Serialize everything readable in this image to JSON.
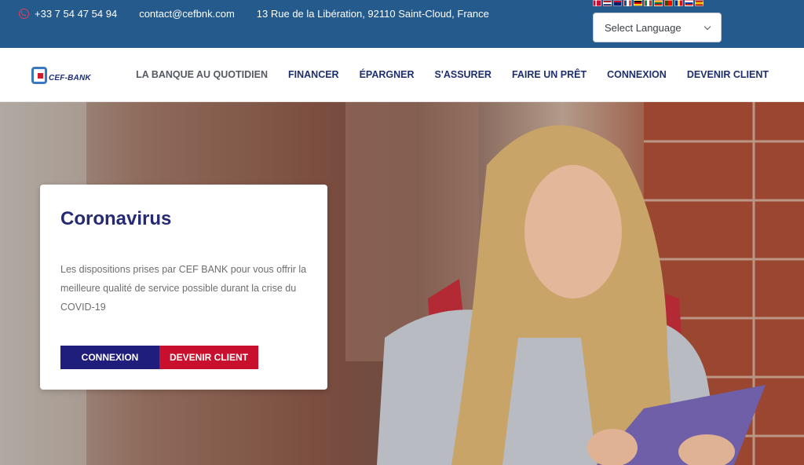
{
  "topbar": {
    "phone": "+33 7 54 47 54 94",
    "email": "contact@cefbnk.com",
    "address": "13 Rue de la Libération, 92110 Saint-Cloud, France",
    "language_select": {
      "value": "Select Language"
    },
    "flags": [
      {
        "icon": "flag-denmark-icon",
        "colors": [
          "#c60c30",
          "#ffffff"
        ]
      },
      {
        "icon": "flag-netherlands-icon",
        "colors": [
          "#ae1c28",
          "#ffffff",
          "#21468b"
        ]
      },
      {
        "icon": "flag-uk-icon",
        "colors": [
          "#012169",
          "#ffffff",
          "#c8102e"
        ]
      },
      {
        "icon": "flag-france-icon",
        "colors": [
          "#0055a4",
          "#ffffff",
          "#ef4135"
        ]
      },
      {
        "icon": "flag-germany-icon",
        "colors": [
          "#000000",
          "#dd0000",
          "#ffce00"
        ]
      },
      {
        "icon": "flag-italy-icon",
        "colors": [
          "#009246",
          "#ffffff",
          "#ce2b37"
        ]
      },
      {
        "icon": "flag-lithuania-icon",
        "colors": [
          "#fdb913",
          "#006a44",
          "#c1272d"
        ]
      },
      {
        "icon": "flag-portugal-icon",
        "colors": [
          "#006600",
          "#ff0000"
        ]
      },
      {
        "icon": "flag-romania-icon",
        "colors": [
          "#002b7f",
          "#fcd116",
          "#ce1126"
        ]
      },
      {
        "icon": "flag-russia-icon",
        "colors": [
          "#ffffff",
          "#0039a6",
          "#d52b1e"
        ]
      },
      {
        "icon": "flag-spain-icon",
        "colors": [
          "#aa151b",
          "#f1bf00",
          "#aa151b"
        ]
      }
    ]
  },
  "logo": {
    "text": "CEF-BANK"
  },
  "nav": {
    "items": [
      "LA BANQUE AU QUOTIDIEN",
      "FINANCER",
      "ÉPARGNER",
      "S'ASSURER",
      "FAIRE UN PRÊT",
      "CONNEXION",
      "DEVENIR CLIENT"
    ]
  },
  "hero": {
    "card": {
      "title": "Coronavirus",
      "body": "Les dispositions prises par CEF BANK pour vous offrir la meilleure qualité de service possible durant la crise du COVID-19",
      "primary_button": "CONNEXION",
      "secondary_button": "DEVENIR CLIENT"
    }
  },
  "colors": {
    "topbar": "#245a8c",
    "nav_text": "#1f2f6e",
    "title": "#262a73",
    "button_blue": "#1f1e7c",
    "button_red": "#c8102e"
  }
}
